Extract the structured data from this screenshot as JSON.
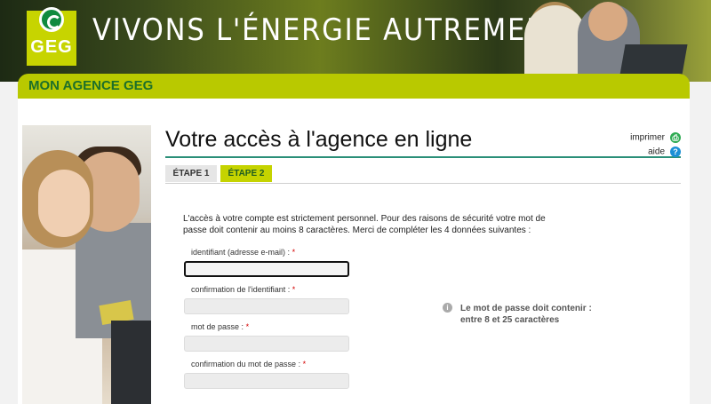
{
  "header": {
    "logo_text": "GEG",
    "tagline": "VIVONS L'ÉNERGIE AUTREMENT"
  },
  "nav": {
    "title": "MON AGENCE GEG"
  },
  "page": {
    "title": "Votre accès à l'agence en ligne",
    "print_label": "imprimer",
    "help_label": "aide"
  },
  "tabs": [
    {
      "label": "ÉTAPE 1",
      "active": false
    },
    {
      "label": "ÉTAPE 2",
      "active": true
    }
  ],
  "form": {
    "intro": "L'accès à votre compte est strictement personnel. Pour des raisons de sécurité votre mot de passe doit contenir au moins 8 caractères. Merci de compléter les 4 données suivantes :",
    "fields": [
      {
        "label": "identifiant (adresse e-mail) :",
        "value": ""
      },
      {
        "label": "confirmation de l'identifiant :",
        "value": ""
      },
      {
        "label": "mot de passe :",
        "value": ""
      },
      {
        "label": "confirmation du mot de passe :",
        "value": ""
      }
    ],
    "required_mark": "*"
  },
  "hint": {
    "line1": "Le mot de passe doit contenir :",
    "line2": "entre 8 et 25 caractères"
  },
  "colors": {
    "accent": "#b9c900",
    "brand_green": "#1c6f2a",
    "title_rule": "#2a8f78"
  }
}
